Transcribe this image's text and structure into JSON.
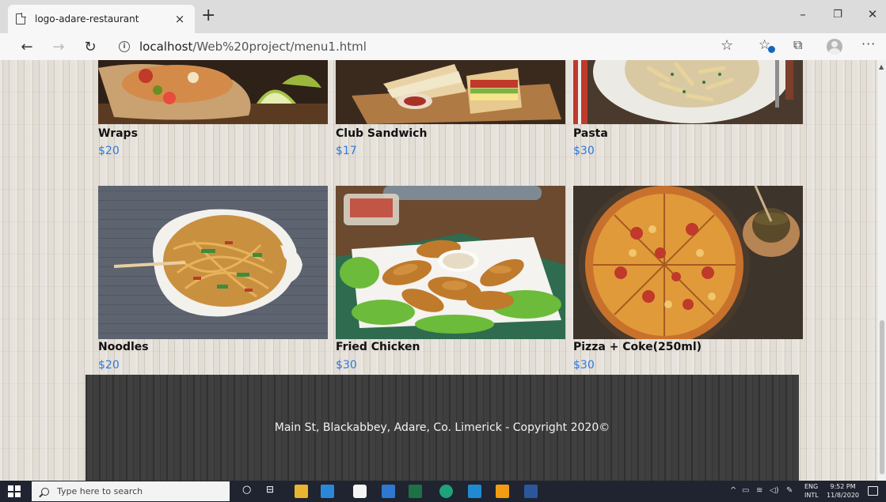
{
  "browser": {
    "tab_title": "logo-adare-restaurant",
    "tab_close": "×",
    "new_tab": "+",
    "url_host": "localhost",
    "url_path": "/Web%20project/menu1.html",
    "window_controls": {
      "minimize": "–",
      "restore": "❐",
      "close": "✕"
    },
    "nav": {
      "back": "←",
      "forward": "→",
      "refresh": "↻"
    },
    "toolbar": {
      "favorite": "☆",
      "favorites_list": "☆",
      "collections": "⧉",
      "more": "···"
    }
  },
  "menu": {
    "items": [
      {
        "name": "Wraps",
        "price": "$20"
      },
      {
        "name": "Club Sandwich",
        "price": "$17"
      },
      {
        "name": "Pasta",
        "price": "$30"
      },
      {
        "name": "Noodles",
        "price": "$20"
      },
      {
        "name": "Fried Chicken",
        "price": "$30"
      },
      {
        "name": "Pizza + Coke(250ml)",
        "price": "$30"
      }
    ]
  },
  "footer": {
    "text": "Main St, Blackabbey, Adare, Co. Limerick - Copyright 2020©"
  },
  "taskbar": {
    "search_placeholder": "Type here to search",
    "tray_chevron": "^",
    "lang_top": "ENG",
    "lang_bottom": "INTL",
    "time": "9:52 PM",
    "date": "11/8/2020"
  },
  "colors": {
    "price": "#2a7ae2",
    "footer_bg": "#3a3a3a",
    "taskbar_bg": "#1f2430"
  }
}
